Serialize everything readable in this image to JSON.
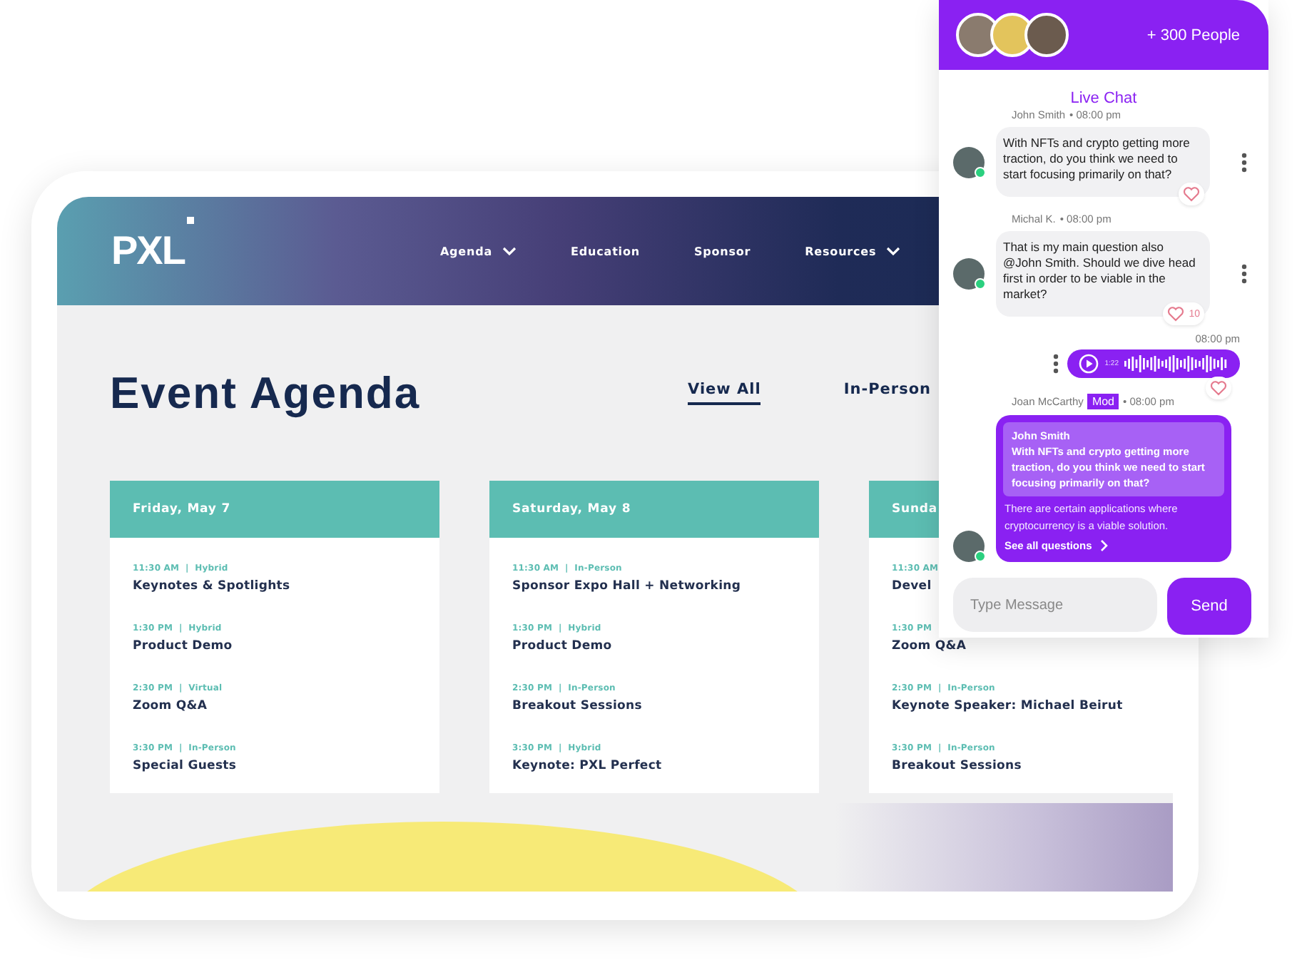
{
  "site": {
    "logo": "PXL",
    "nav": [
      {
        "label": "Agenda",
        "dropdown": true
      },
      {
        "label": "Education",
        "dropdown": false
      },
      {
        "label": "Sponsor",
        "dropdown": false
      },
      {
        "label": "Resources",
        "dropdown": true
      }
    ]
  },
  "agenda": {
    "title": "Event Agenda",
    "filters": [
      {
        "label": "View All",
        "selected": true
      },
      {
        "label": "In-Person",
        "selected": false
      }
    ],
    "days": [
      {
        "title": "Friday, May 7",
        "sessions": [
          {
            "meta": "11:30 AM  |  Hybrid",
            "title": "Keynotes & Spotlights"
          },
          {
            "meta": "1:30 PM  |  Hybrid",
            "title": "Product Demo"
          },
          {
            "meta": "2:30 PM  |  Virtual",
            "title": "Zoom Q&A"
          },
          {
            "meta": "3:30 PM  |  In-Person",
            "title": "Special Guests"
          }
        ]
      },
      {
        "title": "Saturday, May 8",
        "sessions": [
          {
            "meta": "11:30 AM  |  In-Person",
            "title": "Sponsor Expo Hall + Networking"
          },
          {
            "meta": "1:30 PM  |  Hybrid",
            "title": "Product Demo"
          },
          {
            "meta": "2:30 PM  |  In-Person",
            "title": "Breakout Sessions"
          },
          {
            "meta": "3:30 PM  |  Hybrid",
            "title": "Keynote: PXL Perfect"
          }
        ]
      },
      {
        "title": "Sunda",
        "sessions": [
          {
            "meta": "11:30 AM",
            "title": "Devel"
          },
          {
            "meta": "1:30 PM",
            "title": "Zoom Q&A"
          },
          {
            "meta": "2:30 PM  |  In-Person",
            "title": "Keynote Speaker: Michael Beirut"
          },
          {
            "meta": "3:30 PM  |  In-Person",
            "title": "Breakout Sessions"
          }
        ]
      }
    ]
  },
  "chat": {
    "people": "+ 300 People",
    "title": "Live Chat",
    "messages": [
      {
        "kind": "text",
        "author": "John Smith",
        "time": "• 08:00 pm",
        "online": true,
        "text": "With NFTs and crypto getting more traction, do you think we need to start focusing primarily on that?"
      },
      {
        "kind": "text",
        "author": "Michal K.",
        "time": "• 08:00 pm",
        "online": true,
        "text": "That is my main question also @John Smith. Should we dive head first in order to be viable in the market?",
        "likes": "10"
      },
      {
        "kind": "voice",
        "time": "08:00 pm",
        "duration": "1:22"
      },
      {
        "kind": "reply",
        "author": "Joan McCarthy",
        "badge": "Mod",
        "time": "• 08:00 pm",
        "online": true,
        "quote_author": "John Smith",
        "quote": "With NFTs and crypto getting more traction, do you think we need to start focusing primarily on that?",
        "text": "There are certain applications where cryptocurrency is a viable solution.",
        "link": "See all questions"
      }
    ],
    "input": {
      "placeholder": "Type Message"
    },
    "send": "Send"
  }
}
